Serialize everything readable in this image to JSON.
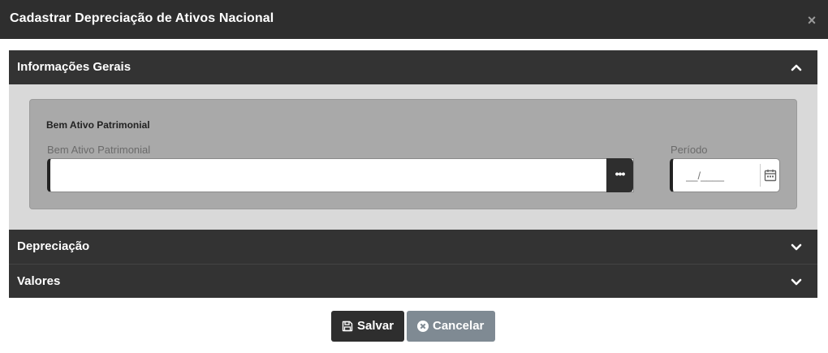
{
  "modal": {
    "title": "Cadastrar Depreciação de Ativos Nacional",
    "close_glyph": "×"
  },
  "sections": {
    "general": {
      "label": "Informações Gerais",
      "expanded": true,
      "icon": "chevron-up-icon"
    },
    "depreciation": {
      "label": "Depreciação",
      "expanded": false,
      "icon": "chevron-down-icon"
    },
    "values": {
      "label": "Valores",
      "expanded": false,
      "icon": "chevron-down-icon"
    }
  },
  "asset_group": {
    "title": "Bem Ativo Patrimonial",
    "asset_field": {
      "label": "Bem Ativo Patrimonial",
      "value": "",
      "lookup_glyph": "•••"
    },
    "period_field": {
      "label": "Período",
      "value": "",
      "mask_placeholder": "__/____",
      "icon": "calendar-icon"
    }
  },
  "footer": {
    "save_label": "Salvar",
    "save_icon": "floppy-disk-icon",
    "cancel_label": "Cancelar",
    "cancel_icon": "x-circle-icon"
  },
  "colors": {
    "header_bg": "#2e2e2e",
    "accordion_bg": "#333333",
    "panel_bg": "#d9d9d9",
    "group_bg": "#a9a9a9",
    "cancel_bg": "#7f8a93"
  }
}
